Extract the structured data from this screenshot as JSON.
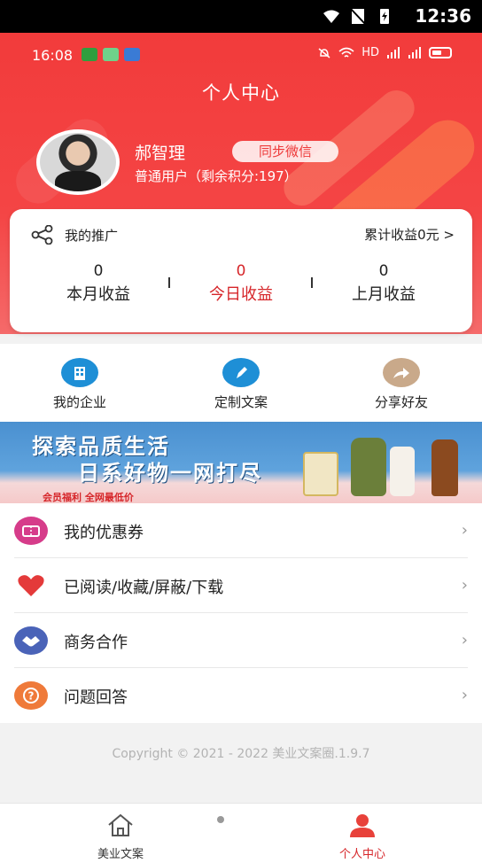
{
  "device_status": {
    "time": "12:36"
  },
  "phone_status": {
    "time": "16:08",
    "network": "HD"
  },
  "header": {
    "title": "个人中心"
  },
  "user": {
    "name": "郝智理",
    "sync_button": "同步微信",
    "level": "普通用户（剩余积分:197）"
  },
  "promotion": {
    "title": "我的推广",
    "total": "累计收益0元 >",
    "stats": [
      {
        "value": "0",
        "label": "本月收益"
      },
      {
        "value": "0",
        "label": "今日收益"
      },
      {
        "value": "0",
        "label": "上月收益"
      }
    ]
  },
  "actions": [
    {
      "label": "我的企业",
      "icon": "building-icon",
      "color": "#1e8fd6"
    },
    {
      "label": "定制文案",
      "icon": "pencil-icon",
      "color": "#1e8fd6"
    },
    {
      "label": "分享好友",
      "icon": "share-arrow-icon",
      "color": "#c9a98a"
    }
  ],
  "banner": {
    "line1": "探索品质生活",
    "line2": "日系好物一网打尽",
    "tag": "会员福利 全网最低价"
  },
  "menu": [
    {
      "label": "我的优惠券",
      "icon": "coupon-icon",
      "color": "#d63c8a"
    },
    {
      "label": "已阅读/收藏/屏蔽/下载",
      "icon": "heart-icon",
      "color": "#e43a3a"
    },
    {
      "label": "商务合作",
      "icon": "handshake-icon",
      "color": "#4a63b8"
    },
    {
      "label": "问题回答",
      "icon": "question-icon",
      "color": "#ef7a3a"
    }
  ],
  "copyright": "Copyright © 2021 - 2022 美业文案圈.1.9.7",
  "bottom_nav": [
    {
      "label": "美业文案",
      "icon": "home-icon",
      "active": false
    },
    {
      "label": "个人中心",
      "icon": "person-icon",
      "active": true
    }
  ],
  "colors": {
    "brand_red": "#f23b3b",
    "active_red": "#d6262a"
  }
}
